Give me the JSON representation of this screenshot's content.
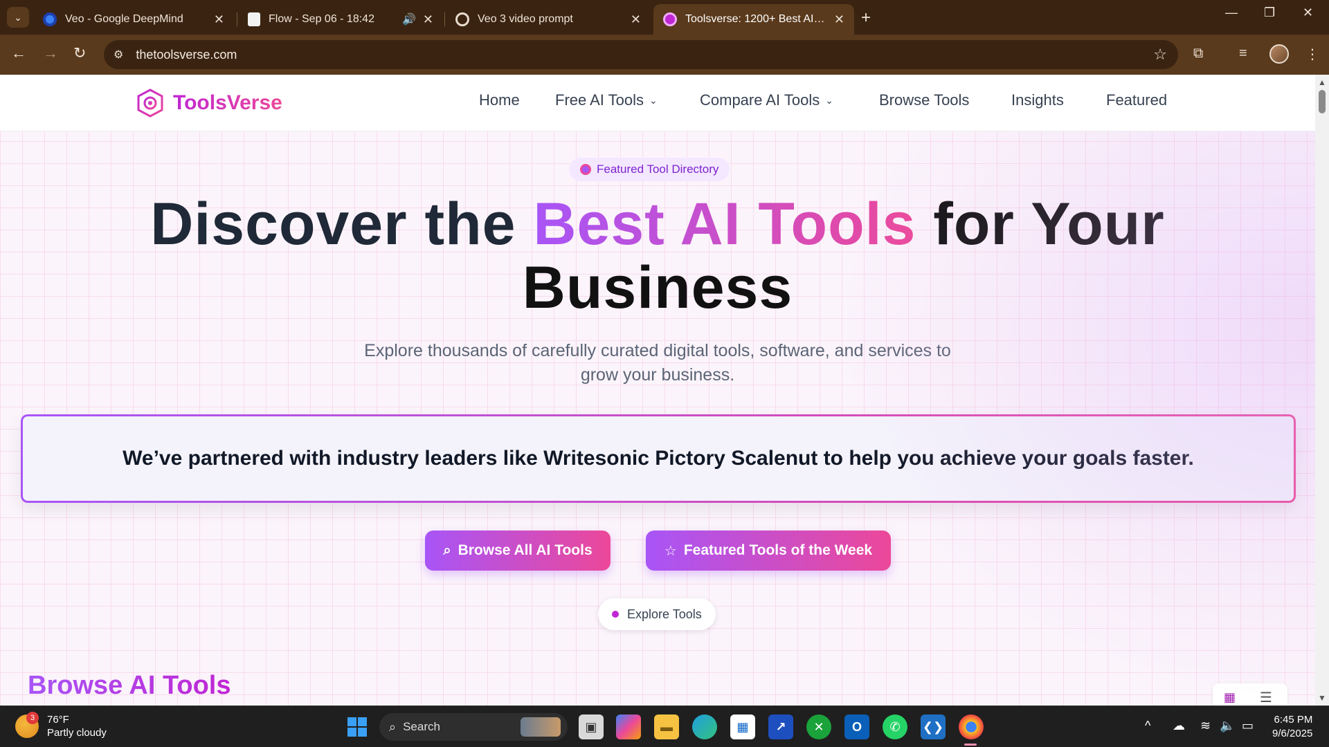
{
  "browser": {
    "tabs": [
      {
        "title": "Veo - Google DeepMind",
        "favicon": "deepmind-icon",
        "active": false
      },
      {
        "title": "Flow - Sep 06 - 18:42",
        "favicon": "document-icon",
        "active": false,
        "audio": true
      },
      {
        "title": "Veo 3 video prompt",
        "favicon": "openai-icon",
        "active": false
      },
      {
        "title": "Toolsverse: 1200+ Best AI Tools",
        "favicon": "toolsverse-icon",
        "active": true
      }
    ],
    "url": "thetoolsverse.com",
    "chrome_color": "#5a3a1c"
  },
  "site": {
    "brand": "ToolsVerse",
    "nav": [
      {
        "label": "Home",
        "dropdown": false
      },
      {
        "label": "Free AI Tools",
        "dropdown": true
      },
      {
        "label": "Compare AI Tools",
        "dropdown": true
      },
      {
        "label": "Browse Tools",
        "dropdown": false
      },
      {
        "label": "Insights",
        "dropdown": false
      },
      {
        "label": "Featured",
        "dropdown": false
      }
    ],
    "accent_colors": {
      "purple": "#a855f7",
      "pink": "#ec4899"
    }
  },
  "hero": {
    "pill": "Featured Tool Directory",
    "title_part1": "Discover the ",
    "title_highlight": "Best AI Tools",
    "title_part2": " for Your",
    "title_line2": "Business",
    "subtitle": "Explore thousands of carefully curated digital tools, software, and services to grow your business.",
    "partner_text": "We’ve partnered with industry leaders like Writesonic Pictory Scalenut to help you achieve your goals faster.",
    "cta_primary": "Browse All AI Tools",
    "cta_secondary": "Featured Tools of the Week",
    "explore": "Explore Tools"
  },
  "section": {
    "heading": "Browse AI Tools"
  },
  "taskbar": {
    "weather_temp": "76°F",
    "weather_desc": "Partly cloudy",
    "weather_badge": "3",
    "search_label": "Search",
    "time": "6:45 PM",
    "date": "9/6/2025"
  }
}
